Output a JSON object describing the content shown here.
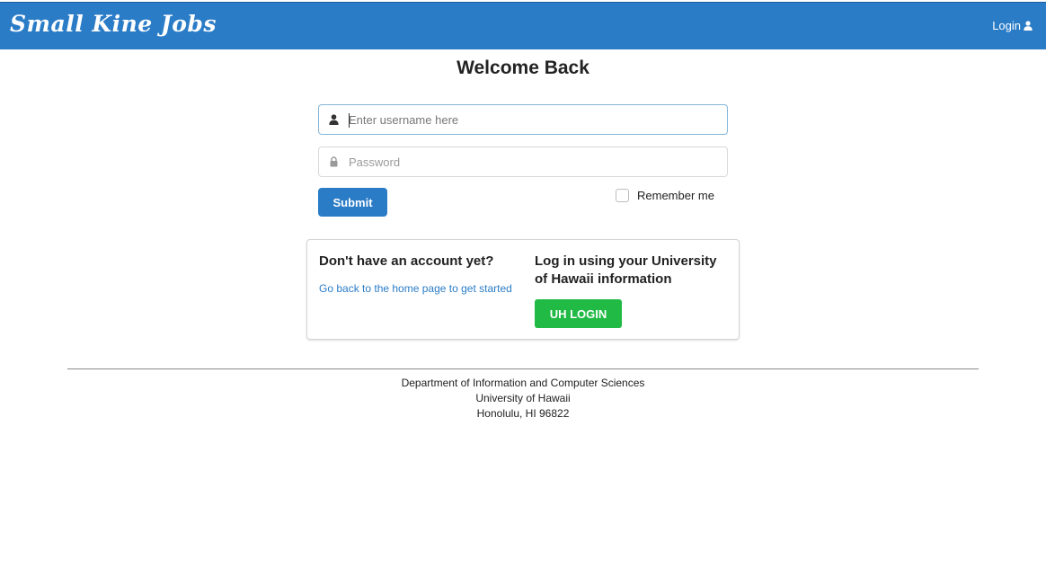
{
  "navbar": {
    "brand": "Small Kine Jobs",
    "login_label": "Login",
    "login_icon": "user-icon",
    "color": "#2a7cc7"
  },
  "page": {
    "title": "Welcome Back"
  },
  "form": {
    "username_placeholder": "Enter username here",
    "username_icon": "user-icon",
    "password_placeholder": "Password",
    "password_icon": "lock-icon",
    "submit_label": "Submit",
    "remember_label": "Remember me"
  },
  "card": {
    "signup_heading": "Don't have an account yet?",
    "signup_link": "Go back to the home page to get started",
    "uh_heading": "Log in using your University of Hawaii information",
    "uh_button": "UH LOGIN",
    "uh_button_color": "#21ba45"
  },
  "footer": {
    "line1": "Department of Information and Computer Sciences",
    "line2": "University of Hawaii",
    "line3": "Honolulu, HI 96822"
  }
}
